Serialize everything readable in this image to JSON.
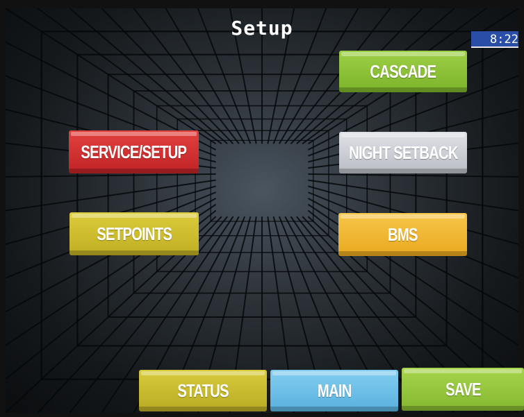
{
  "header": {
    "title": "Setup",
    "clock": "8:22"
  },
  "buttons": {
    "cascade": "CASCADE",
    "service_setup": "SERVICE/SETUP",
    "night_setback": "NIGHT SETBACK",
    "setpoints": "SETPOINTS",
    "bms": "BMS"
  },
  "bottom_bar": {
    "status": "STATUS",
    "main": "MAIN",
    "save": "SAVE"
  },
  "colors": {
    "cascade": "#8cc23a",
    "service_setup": "#d12f30",
    "night_setback": "#cfd2d8",
    "setpoints": "#cdbd2e",
    "bms": "#f0b632",
    "status": "#c9bc30",
    "main": "#6cc0e8",
    "save": "#95c63e",
    "clock_bg": "#2a4ea8"
  }
}
